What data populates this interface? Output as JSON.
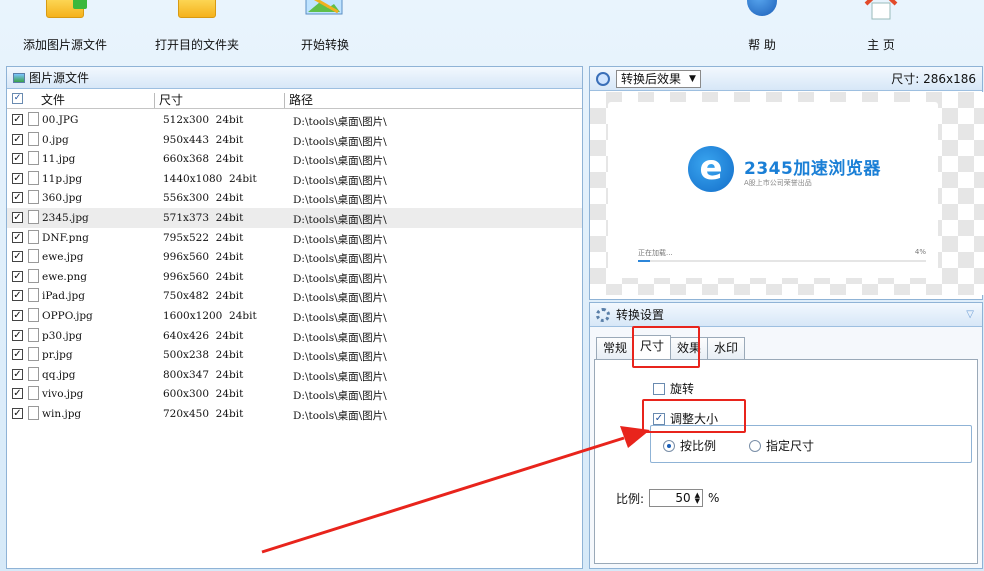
{
  "toolbar": {
    "add_source": "添加图片源文件",
    "open_target": "打开目的文件夹",
    "start_convert": "开始转换",
    "help": "帮 助",
    "home": "主 页"
  },
  "source_panel": {
    "title": "图片源文件",
    "columns": {
      "file": "文件",
      "size": "尺寸",
      "path": "路径"
    },
    "rows": [
      {
        "name": "00.JPG",
        "size": "512x300  24bit",
        "path": "D:\\tools\\桌面\\图片\\",
        "checked": true
      },
      {
        "name": "0.jpg",
        "size": "950x443  24bit",
        "path": "D:\\tools\\桌面\\图片\\",
        "checked": true
      },
      {
        "name": "11.jpg",
        "size": "660x368  24bit",
        "path": "D:\\tools\\桌面\\图片\\",
        "checked": true
      },
      {
        "name": "11p.jpg",
        "size": "1440x1080  24bit",
        "path": "D:\\tools\\桌面\\图片\\",
        "checked": true
      },
      {
        "name": "360.jpg",
        "size": "556x300  24bit",
        "path": "D:\\tools\\桌面\\图片\\",
        "checked": true
      },
      {
        "name": "2345.jpg",
        "size": "571x373  24bit",
        "path": "D:\\tools\\桌面\\图片\\",
        "checked": true
      },
      {
        "name": "DNF.png",
        "size": "795x522  24bit",
        "path": "D:\\tools\\桌面\\图片\\",
        "checked": true
      },
      {
        "name": "ewe.jpg",
        "size": "996x560  24bit",
        "path": "D:\\tools\\桌面\\图片\\",
        "checked": true
      },
      {
        "name": "ewe.png",
        "size": "996x560  24bit",
        "path": "D:\\tools\\桌面\\图片\\",
        "checked": true
      },
      {
        "name": "iPad.jpg",
        "size": "750x482  24bit",
        "path": "D:\\tools\\桌面\\图片\\",
        "checked": true
      },
      {
        "name": "OPPO.jpg",
        "size": "1600x1200  24bit",
        "path": "D:\\tools\\桌面\\图片\\",
        "checked": true
      },
      {
        "name": "p30.jpg",
        "size": "640x426  24bit",
        "path": "D:\\tools\\桌面\\图片\\",
        "checked": true
      },
      {
        "name": "pr.jpg",
        "size": "500x238  24bit",
        "path": "D:\\tools\\桌面\\图片\\",
        "checked": true
      },
      {
        "name": "qq.jpg",
        "size": "800x347  24bit",
        "path": "D:\\tools\\桌面\\图片\\",
        "checked": true
      },
      {
        "name": "vivo.jpg",
        "size": "600x300  24bit",
        "path": "D:\\tools\\桌面\\图片\\",
        "checked": true
      },
      {
        "name": "win.jpg",
        "size": "720x450  24bit",
        "path": "D:\\tools\\桌面\\图片\\",
        "checked": true
      }
    ],
    "selected_row": "2345.jpg"
  },
  "preview": {
    "mode_select": "转换后效果",
    "size_label": "尺寸: 286x186",
    "image": {
      "brand": "2345加速浏览器",
      "tagline": "A股上市公司荣誉出品",
      "loading": "正在加载...",
      "percent": "4%",
      "progress": 0.04
    }
  },
  "settings": {
    "title": "转换设置",
    "tabs": [
      "常规",
      "尺寸",
      "效果",
      "水印"
    ],
    "active_tab": "尺寸",
    "rotate_label": "旋转",
    "rotate_checked": false,
    "resize_label": "调整大小",
    "resize_checked": true,
    "proportional_label": "按比例",
    "fixed_size_label": "指定尺寸",
    "mode": "proportional",
    "ratio_label": "比例:",
    "ratio_value": "50",
    "ratio_unit": "%"
  },
  "colors": {
    "annotation_red": "#e8241c",
    "header_blue": "#d7e7f7",
    "brand_blue": "#1a7fd6"
  }
}
